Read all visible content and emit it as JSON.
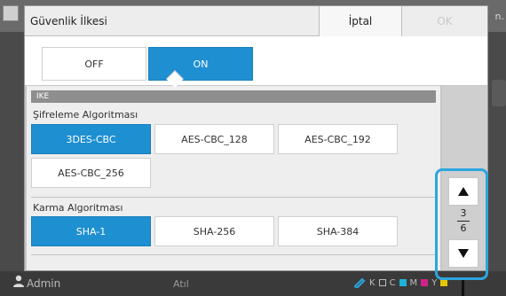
{
  "background": {
    "corner_text": "n.",
    "status": {
      "user": "Admin",
      "state": "Atıl",
      "ink_labels": [
        "K",
        "C",
        "M",
        "Y"
      ]
    }
  },
  "dialog": {
    "title": "Güvenlik İlkesi",
    "cancel_label": "İptal",
    "ok_label": "OK",
    "toggle": {
      "off_label": "OFF",
      "on_label": "ON",
      "selected": "ON"
    },
    "section_header": "IKE",
    "encryption": {
      "label": "Şifreleme Algoritması",
      "options": [
        "3DES-CBC",
        "AES-CBC_128",
        "AES-CBC_192",
        "AES-CBC_256"
      ],
      "selected": "3DES-CBC"
    },
    "hash": {
      "label": "Karma Algoritması",
      "options": [
        "SHA-1",
        "SHA-256",
        "SHA-384"
      ],
      "selected": "SHA-1"
    },
    "scroll": {
      "up_icon": "up-triangle-icon",
      "down_icon": "down-triangle-icon",
      "current_page": "3",
      "total_pages": "6"
    }
  },
  "colors": {
    "accent": "#1e8fd0",
    "highlight": "#2da6de",
    "section_bar": "#8e8e8e"
  }
}
